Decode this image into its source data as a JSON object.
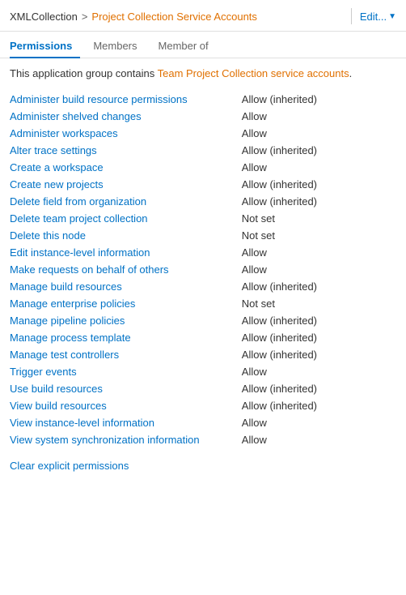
{
  "breadcrumb": {
    "collection": "XMLCollection",
    "separator": ">",
    "current": "Project Collection Service Accounts"
  },
  "edit_button": {
    "label": "Edit..."
  },
  "tabs": [
    {
      "label": "Permissions",
      "active": true
    },
    {
      "label": "Members",
      "active": false
    },
    {
      "label": "Member of",
      "active": false
    }
  ],
  "description": {
    "prefix": "This application group contains ",
    "highlight": "Team Project Collection service accounts",
    "suffix": "."
  },
  "permissions": [
    {
      "name": "Administer build resource permissions",
      "value": "Allow (inherited)"
    },
    {
      "name": "Administer shelved changes",
      "value": "Allow"
    },
    {
      "name": "Administer workspaces",
      "value": "Allow"
    },
    {
      "name": "Alter trace settings",
      "value": "Allow (inherited)"
    },
    {
      "name": "Create a workspace",
      "value": "Allow"
    },
    {
      "name": "Create new projects",
      "value": "Allow (inherited)"
    },
    {
      "name": "Delete field from organization",
      "value": "Allow (inherited)"
    },
    {
      "name": "Delete team project collection",
      "value": "Not set"
    },
    {
      "name": "Delete this node",
      "value": "Not set"
    },
    {
      "name": "Edit instance-level information",
      "value": "Allow"
    },
    {
      "name": "Make requests on behalf of others",
      "value": "Allow"
    },
    {
      "name": "Manage build resources",
      "value": "Allow (inherited)"
    },
    {
      "name": "Manage enterprise policies",
      "value": "Not set"
    },
    {
      "name": "Manage pipeline policies",
      "value": "Allow (inherited)"
    },
    {
      "name": "Manage process template",
      "value": "Allow (inherited)"
    },
    {
      "name": "Manage test controllers",
      "value": "Allow (inherited)"
    },
    {
      "name": "Trigger events",
      "value": "Allow"
    },
    {
      "name": "Use build resources",
      "value": "Allow (inherited)"
    },
    {
      "name": "View build resources",
      "value": "Allow (inherited)"
    },
    {
      "name": "View instance-level information",
      "value": "Allow"
    },
    {
      "name": "View system synchronization information",
      "value": "Allow"
    }
  ],
  "clear_link": "Clear explicit permissions",
  "bottom_buttons": []
}
